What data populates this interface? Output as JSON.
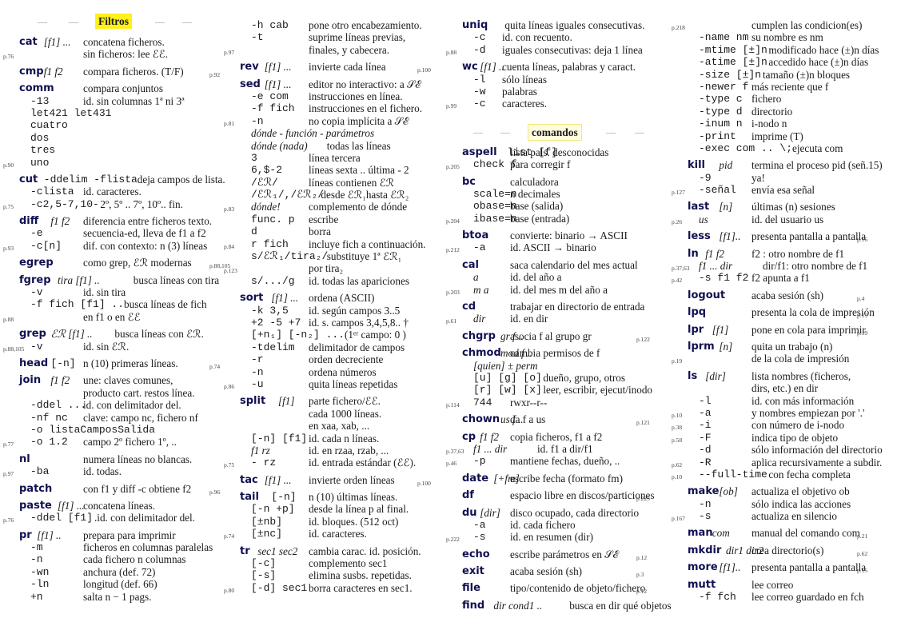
{
  "headers": {
    "filtros": "Filtros",
    "comandos": "comandos",
    "dash": "—"
  },
  "col1": [
    {
      "cmd": "cat",
      "lines": [
        [
          "[f1] ...",
          "concatena ficheros."
        ],
        [
          "",
          "sin ficheros: lee ℰℰ."
        ]
      ],
      "page": "p.76",
      "pageLine": 1
    },
    {
      "cmd": "cmp",
      "lines": [
        [
          "f1 f2",
          "compara ficheros. (T/F)"
        ]
      ],
      "page": "p.92",
      "pageRight": true
    },
    {
      "cmd": "comm",
      "lines": [
        [
          "",
          "compara conjuntos"
        ],
        [
          "-13",
          "id. sin columnas 1ª ni 3ª"
        ],
        [
          "let421 let431",
          ""
        ],
        [
          "cuatro",
          ""
        ],
        [
          "dos",
          ""
        ],
        [
          "tres",
          ""
        ],
        [
          "uno",
          ""
        ]
      ],
      "page": "p.90",
      "pageLine": 6
    },
    {
      "cmd": "cut",
      "lines": [
        [
          "-ddelim -flista",
          "deja campos de lista."
        ],
        [
          "-clista",
          "id. caracteres."
        ],
        [
          "-c2,5-7,10-",
          "2º, 5º .. 7º, 10º.. fin."
        ]
      ],
      "page": "p.75",
      "pageLine": 2
    },
    {
      "cmd": "diff",
      "lines": [
        [
          "f1 f2",
          "diferencia entre ficheros texto."
        ],
        [
          "-e",
          "secuencia-ed, lleva de f1 a f2"
        ],
        [
          "-c[n]",
          "dif. con contexto: n (3) líneas"
        ]
      ],
      "page": "p.93",
      "pageLine": 2
    },
    {
      "cmd": "egrep",
      "lines": [
        [
          "",
          "como grep, ℰℛ modernas"
        ]
      ],
      "page": "p.88,105",
      "pageRight": true
    },
    {
      "cmd": "fgrep",
      "lines": [
        [
          "tira [f1] ..",
          "busca líneas con tira"
        ],
        [
          "-v",
          "id. sin tira"
        ],
        [
          "-f fich [f1] ..",
          "busca líneas de fich"
        ],
        [
          "",
          "en f1 o en ℰℰ"
        ]
      ],
      "page": "p.88",
      "pageLine": 3
    },
    {
      "cmd": "grep",
      "lines": [
        [
          "ℰℛ [f1] ..",
          "busca líneas con ℰℛ."
        ],
        [
          "-v",
          "id. sin ℰℛ."
        ]
      ],
      "page": "p.88,105",
      "pageLine": 1
    },
    {
      "cmd": "head",
      "lines": [
        [
          "[-n]",
          "n (10) primeras líneas."
        ]
      ],
      "page": "p.74",
      "pageRight": true
    },
    {
      "cmd": "join",
      "lines": [
        [
          "f1 f2",
          "une: claves comunes,"
        ],
        [
          "",
          "producto cart. restos línea."
        ],
        [
          "-ddel ...",
          "id. con delimitador del."
        ],
        [
          "-nf nc",
          "clave: campo nc, fichero nf"
        ],
        [
          "-o listaCamposSalida",
          ""
        ],
        [
          "-o 1.2",
          "campo 2º fichero 1º, .."
        ]
      ],
      "page": "p.77",
      "pageLine": 5
    },
    {
      "cmd": "nl",
      "lines": [
        [
          "",
          "numera líneas no blancas."
        ],
        [
          "-ba",
          "id. todas."
        ]
      ],
      "page": "p.97",
      "pageLine": 1
    },
    {
      "cmd": "patch",
      "lines": [
        [
          "",
          "con f1 y diff -c obtiene f2"
        ]
      ],
      "page": "p.96",
      "pageRight": true
    },
    {
      "cmd": "paste",
      "lines": [
        [
          "[f1] ...",
          "concatena líneas."
        ],
        [
          "-ddel [f1]",
          ".id. con delimitador del."
        ]
      ],
      "page": "p.76",
      "pageLine": 1
    },
    {
      "cmd": "pr",
      "lines": [
        [
          "[f1] ..",
          "prepara para imprimir"
        ],
        [
          "-m",
          "ficheros en columnas paralelas"
        ],
        [
          "-n",
          "cada fichero n columnas"
        ],
        [
          "-wn",
          "anchura (def. 72)"
        ],
        [
          "-ln",
          "longitud (def. 66)"
        ],
        [
          "+n",
          "salta n − 1 pags."
        ]
      ]
    }
  ],
  "col2": [
    {
      "cmd": "",
      "lines": [
        [
          "-h cab",
          "pone otro encabezamiento."
        ],
        [
          "-t",
          "suprime líneas previas,"
        ],
        [
          "",
          "finales, y cabecera."
        ]
      ],
      "page": "p.97",
      "pageLine": 2
    },
    {
      "cmd": "rev",
      "lines": [
        [
          "[f1] ...",
          "invierte cada línea"
        ]
      ],
      "page": "p.100",
      "pageRight": true
    },
    {
      "cmd": "sed",
      "lines": [
        [
          "[f1] ...",
          "editor no interactivo: a 𝒮ℰ"
        ],
        [
          "-e com",
          "instrucciones en línea."
        ],
        [
          "-f fich",
          "instrucciones en el fichero."
        ],
        [
          "-n",
          "no copia implícita a 𝒮ℰ"
        ],
        [
          "dónde - función - parámetros",
          ""
        ],
        [
          "dónde (nada)",
          "todas las líneas"
        ],
        [
          "3",
          "línea tercera"
        ],
        [
          "6,$-2",
          "líneas sexta .. última - 2"
        ],
        [
          "/ℰℛ/",
          "líneas contienen ℰℛ"
        ],
        [
          "/ℰℛ₁/,/ℰℛ₂/",
          "desde ℰℛ₁hasta ℰℛ₂"
        ],
        [
          "dónde!",
          "complemento de dónde"
        ],
        [
          "func. p",
          "escribe"
        ],
        [
          "d",
          "borra"
        ],
        [
          "r fich",
          "incluye fich a continuación."
        ],
        [
          "s/ℰℛ₁/tira₂/",
          "substituye 1ª ℰℛ₁"
        ],
        [
          "",
          "por tira₂"
        ],
        [
          "s/.../g",
          "id. todas las apariciones"
        ]
      ],
      "pages": [
        [
          "p.81",
          3
        ],
        [
          "p.83",
          10
        ],
        [
          "p.84",
          13
        ],
        [
          "p.123",
          15
        ]
      ]
    },
    {
      "cmd": "sort",
      "lines": [
        [
          "[f1] ...",
          "ordena (ASCII)"
        ],
        [
          "-k 3,5",
          "id. según campos 3..5"
        ],
        [
          "+2 -5 +7",
          "id. s. campos 3,4,5,8.. †"
        ],
        [
          "[+n₁] [-n₂] ...",
          "(1ᵉʳ campo: 0 )"
        ],
        [
          "-tdelim",
          "delimitador de campos"
        ],
        [
          "-r",
          "orden decreciente"
        ],
        [
          "-n",
          "ordena números"
        ],
        [
          "-u",
          "quita líneas repetidas"
        ]
      ],
      "page": "p.86",
      "pageLine": 7
    },
    {
      "cmd": "split",
      "lines": [
        [
          "[f1]",
          "parte fichero/ℰℰ."
        ],
        [
          "",
          "cada 1000 líneas."
        ],
        [
          "",
          "en xaa, xab, ..."
        ],
        [
          "[-n] [f1]",
          "id. cada n líneas."
        ],
        [
          "f1 rz",
          "id. en rzaa, rzab, ..."
        ],
        [
          "- rz",
          "id. entrada estándar (ℰℰ)."
        ]
      ],
      "page": "p.75",
      "pageLine": 5
    },
    {
      "cmd": "tac",
      "lines": [
        [
          "[f1] ...",
          "invierte orden líneas"
        ]
      ],
      "page": "p.100",
      "pageRight": true
    },
    {
      "cmd": "tail",
      "lines": [
        [
          "[-n]",
          "n (10) últimas líneas."
        ],
        [
          "[-n +p]",
          "desde la línea p al final."
        ],
        [
          "[±nb]",
          "id. bloques. (512 oct)"
        ],
        [
          "[±nc]",
          "id. caracteres."
        ]
      ],
      "page": "p.74",
      "pageLine": 3
    },
    {
      "cmd": "tr",
      "lines": [
        [
          "sec1 sec2",
          "cambia carac. id. posición."
        ],
        [
          "[-c]",
          "complemento sec1"
        ],
        [
          "[-s]",
          "elimina susbs. repetidas."
        ],
        [
          "[-d] sec1",
          "borra caracteres en sec1."
        ]
      ],
      "page": "p.80",
      "pageLine": 3
    }
  ],
  "col3a": [
    {
      "cmd": "uniq",
      "lines": [
        [
          "",
          "quita líneas iguales consecutivas."
        ],
        [
          "-c",
          "id. con recuento."
        ],
        [
          "-d",
          "iguales consecutivas: deja 1 línea"
        ]
      ],
      "page": "p.88",
      "pageLine": 2
    },
    {
      "cmd": "wc",
      "lines": [
        [
          "[f1] ..",
          "cuenta líneas, palabras y caract."
        ],
        [
          "-l",
          "sólo líneas"
        ],
        [
          "-w",
          "palabras"
        ],
        [
          "-c",
          "caracteres."
        ]
      ],
      "page": "p.99",
      "pageLine": 3
    }
  ],
  "col3b": [
    {
      "cmd": "aspell",
      "lines": [
        [
          "list [f]",
          "lista pals. desconocidas"
        ],
        [
          "check f",
          "para corregir f"
        ]
      ],
      "page": "p.205",
      "pageLine": 1
    },
    {
      "cmd": "bc",
      "lines": [
        [
          "",
          "calculadora"
        ],
        [
          "scale=n",
          "n decimales"
        ],
        [
          "obase=n",
          "base (salida)"
        ],
        [
          "ibase=n",
          "base (entrada)"
        ]
      ],
      "page": "p.204",
      "pageLine": 3
    },
    {
      "cmd": "btoa",
      "lines": [
        [
          "",
          "convierte: binario → ASCII"
        ],
        [
          "-a",
          "id.        ASCII → binario"
        ]
      ],
      "page": "p.212",
      "pageLine": 1
    },
    {
      "cmd": "cal",
      "lines": [
        [
          "",
          "saca calendario del mes actual"
        ],
        [
          "a",
          "id. del año a"
        ],
        [
          "m a",
          "id. del mes m del año a"
        ]
      ],
      "page": "p.203",
      "pageLine": 2
    },
    {
      "cmd": "cd",
      "lines": [
        [
          "",
          "trabajar en directorio de entrada"
        ],
        [
          "dir",
          "id. en dir"
        ]
      ],
      "page": "p.61",
      "pageLine": 1
    },
    {
      "cmd": "chgrp",
      "lines": [
        [
          "gr f ..",
          "asocia f al grupo gr"
        ]
      ],
      "page": "p.122",
      "pageRight": true
    },
    {
      "cmd": "chmod",
      "lines": [
        [
          "mod f ..",
          "cambia permisos de f"
        ],
        [
          "[quien] ± perm",
          ""
        ],
        [
          "[u] [g] [o]",
          "dueño, grupo, otros"
        ],
        [
          "[r] [w] [x]",
          "leer, escribir, ejecut/inodo"
        ],
        [
          "744",
          "rwxr--r--"
        ]
      ],
      "page": "p.114",
      "pageLine": 4
    },
    {
      "cmd": "chown",
      "lines": [
        [
          "us f ..",
          "da f a us"
        ]
      ],
      "page": "p.121",
      "pageRight": true
    },
    {
      "cmd": "cp",
      "lines": [
        [
          "f1 f2",
          "copia ficheros, f1 a f2"
        ],
        [
          "f1 ... dir",
          "id. f1 a dir/f1"
        ],
        [
          "-p",
          "mantiene fechas, dueño, .."
        ]
      ],
      "pages": [
        [
          "p.37,63",
          1
        ],
        [
          "p.46",
          2
        ]
      ]
    },
    {
      "cmd": "date",
      "lines": [
        [
          "[+fm]",
          "escribe fecha (formato fm)"
        ]
      ]
    },
    {
      "cmd": "df",
      "lines": [
        [
          "",
          "espacio libre en discos/particiones"
        ]
      ],
      "page": "p.223",
      "pageRight": true
    },
    {
      "cmd": "du",
      "lines": [
        [
          "[dir]",
          "disco ocupado, cada directorio"
        ],
        [
          "-a",
          "id. cada fichero"
        ],
        [
          "-s",
          "id. en resumen (dir)"
        ]
      ],
      "page": "p.222",
      "pageLine": 2
    },
    {
      "cmd": "echo",
      "lines": [
        [
          "",
          "escribe parámetros en 𝒮ℰ"
        ]
      ],
      "page": "p.12",
      "pageRight": true
    },
    {
      "cmd": "exit",
      "lines": [
        [
          "",
          "acaba sesión (sh)"
        ]
      ],
      "page": "p.3",
      "pageRight": true
    },
    {
      "cmd": "file",
      "lines": [
        [
          "",
          "tipo/contenido de objeto/fichero"
        ]
      ],
      "page": "p.12",
      "pageRight": true
    },
    {
      "cmd": "find",
      "lines": [
        [
          "dir cond1 ..",
          "busca en dir qué objetos"
        ]
      ]
    }
  ],
  "col4": [
    {
      "cmd": "",
      "lines": [
        [
          "",
          "cumplen las condicion(es)"
        ],
        [
          "-name nm",
          "su nombre es nm"
        ],
        [
          "-mtime [±]n",
          "modificado hace (±)n días"
        ],
        [
          "-atime [±]n",
          "accedido hace (±)n días"
        ],
        [
          "-size [±]n",
          "tamaño (±)n bloques"
        ],
        [
          "-newer f",
          "más reciente que f"
        ],
        [
          "-type c",
          "fichero"
        ],
        [
          "-type d",
          "directorio"
        ],
        [
          "-inum n",
          "i-nodo n"
        ],
        [
          "-print",
          "imprime (T)"
        ],
        [
          "-exec com .. \\;",
          "ejecuta com"
        ]
      ],
      "page": "p.218",
      "pageLine": 0
    },
    {
      "cmd": "kill",
      "lines": [
        [
          "pid",
          "termina el proceso pid (señ.15)"
        ],
        [
          "-9",
          "ya!"
        ],
        [
          "-señal",
          "envía esa señal"
        ]
      ],
      "page": "p.127",
      "pageLine": 2
    },
    {
      "cmd": "last",
      "lines": [
        [
          "[n]",
          "últimas (n) sesiones"
        ],
        [
          "us",
          "id. del usuario us"
        ]
      ],
      "page": "p.26",
      "pageLine": 1
    },
    {
      "cmd": "less",
      "lines": [
        [
          "[f1]..",
          "presenta pantalla a pantalla"
        ]
      ],
      "page": "p.16",
      "pageRight": true
    },
    {
      "cmd": "ln",
      "lines": [
        [
          "f1 f2",
          "f2 : otro nombre de f1"
        ],
        [
          "f1 ... dir",
          "dir/f1: otro nombre de f1"
        ],
        [
          "-s f1 f2",
          "f2 apunta a f1"
        ]
      ],
      "pages": [
        [
          "p.37,63",
          1
        ],
        [
          "p.42",
          2
        ]
      ]
    },
    {
      "cmd": "logout",
      "lines": [
        [
          "",
          "acaba sesión (sh)"
        ]
      ],
      "page": "p.4",
      "pageRight": true
    },
    {
      "cmd": "lpq",
      "lines": [
        [
          "",
          "presenta la cola de impresión"
        ]
      ],
      "page": "p.19",
      "pageRight": true
    },
    {
      "cmd": "lpr",
      "lines": [
        [
          "[f1]",
          "pone en cola para imprimir"
        ]
      ],
      "page": "p.19",
      "pageRight": true
    },
    {
      "cmd": "lprm",
      "lines": [
        [
          "[n]",
          "quita un trabajo (n)"
        ],
        [
          "",
          "de la cola de impresión"
        ]
      ],
      "page": "p.19",
      "pageLine": 1
    },
    {
      "cmd": "ls",
      "lines": [
        [
          "[dir]",
          "lista nombres (ficheros,"
        ],
        [
          "",
          "dirs, etc.) en dir"
        ],
        [
          "-l",
          "id. con más información"
        ],
        [
          "-a",
          "y nombres empiezan por '.'"
        ],
        [
          "-i",
          "con número de i-nodo"
        ],
        [
          "-F",
          "indica tipo de objeto"
        ],
        [
          "-d",
          "sólo información del directorio"
        ],
        [
          "-R",
          "aplica recursivamente a subdir."
        ],
        [
          "--full-time",
          "con fecha completa"
        ]
      ],
      "pages": [
        [
          "p.10",
          3
        ],
        [
          "p.38",
          4
        ],
        [
          "p.58",
          5
        ],
        [
          "p.62",
          7
        ],
        [
          "p.10",
          8
        ]
      ]
    },
    {
      "cmd": "make",
      "lines": [
        [
          "[ob]",
          "actualiza el objetivo ob"
        ],
        [
          "-n",
          "sólo indica las acciones"
        ],
        [
          "-s",
          "actualiza en silencio"
        ]
      ],
      "page": "p.167",
      "pageLine": 2
    },
    {
      "cmd": "man",
      "lines": [
        [
          "com",
          "manual del comando com"
        ]
      ],
      "page": "p.21",
      "pageRight": true
    },
    {
      "cmd": "mkdir",
      "lines": [
        [
          "dir1 dir2",
          "crea directorio(s)"
        ]
      ],
      "page": "p.62",
      "pageRight": true
    },
    {
      "cmd": "more",
      "lines": [
        [
          "[f1]..",
          "presenta pantalla a pantalla"
        ]
      ],
      "page": "p.15",
      "pageRight": true
    },
    {
      "cmd": "mutt",
      "lines": [
        [
          "",
          "lee correo"
        ],
        [
          "-f fch",
          "lee correo guardado en fch"
        ]
      ]
    }
  ]
}
